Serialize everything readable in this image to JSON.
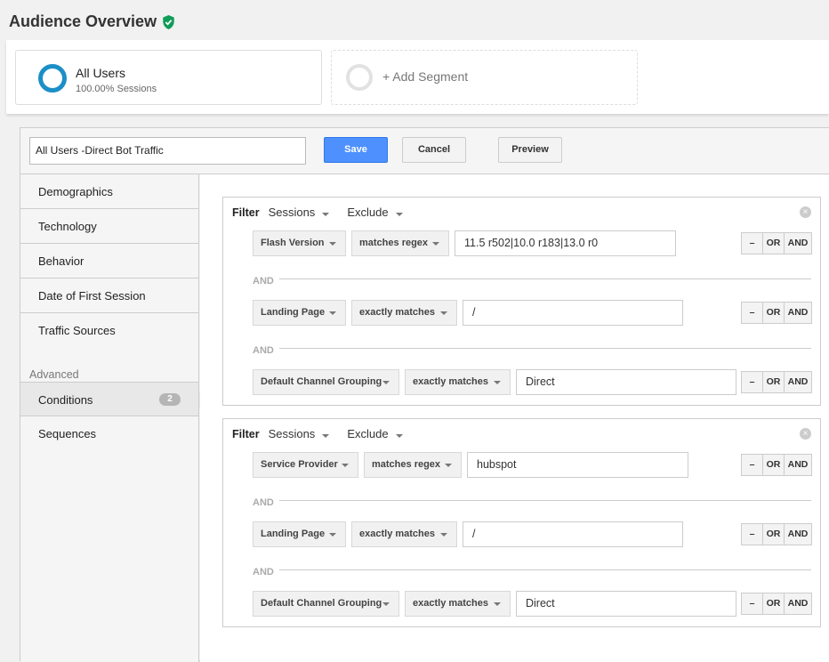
{
  "header": {
    "title": "Audience Overview",
    "verified_icon": "shield-check-icon",
    "accent_color": "#0f9d58"
  },
  "segments": {
    "active": {
      "name": "All Users",
      "subtitle": "100.00% Sessions",
      "ring_color": "#1c8fc8"
    },
    "add_label": "+ Add Segment"
  },
  "editor": {
    "segment_name": "All Users -Direct Bot Traffic",
    "save_label": "Save",
    "cancel_label": "Cancel",
    "preview_label": "Preview",
    "sidebar": {
      "items": [
        "Demographics",
        "Technology",
        "Behavior",
        "Date of First Session",
        "Traffic Sources"
      ],
      "advanced_heading": "Advanced",
      "conditions_label": "Conditions",
      "conditions_count": "2",
      "sequences_label": "Sequences"
    },
    "filters": [
      {
        "label": "Filter",
        "scope": "Sessions",
        "mode": "Exclude",
        "conditions": [
          {
            "dimension": "Flash Version",
            "operator": "matches regex",
            "value": "11.5 r502|10.0 r183|13.0 r0"
          },
          {
            "dimension": "Landing Page",
            "operator": "exactly matches",
            "value": "/"
          },
          {
            "dimension": "Default Channel Grouping",
            "operator": "exactly matches",
            "value": "Direct"
          }
        ]
      },
      {
        "label": "Filter",
        "scope": "Sessions",
        "mode": "Exclude",
        "conditions": [
          {
            "dimension": "Service Provider",
            "operator": "matches regex",
            "value": "hubspot"
          },
          {
            "dimension": "Landing Page",
            "operator": "exactly matches",
            "value": "/"
          },
          {
            "dimension": "Default Channel Grouping",
            "operator": "exactly matches",
            "value": "Direct"
          }
        ]
      }
    ],
    "and_separator": "AND",
    "ops": {
      "minus": "–",
      "or": "OR",
      "and": "AND"
    }
  }
}
